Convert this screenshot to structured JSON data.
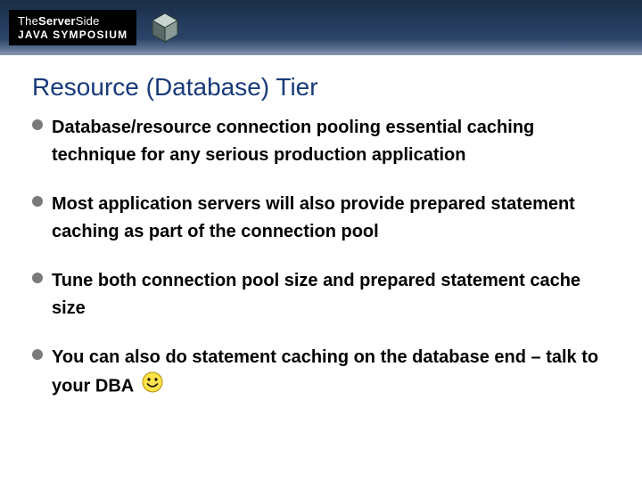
{
  "header": {
    "logo_line1_a": "The",
    "logo_line1_b": "Server",
    "logo_line1_c": "Side",
    "logo_line2": "JAVA SYMPOSIUM"
  },
  "title": "Resource (Database) Tier",
  "bullets": [
    {
      "text": "Database/resource connection pooling essential caching technique for any serious production application"
    },
    {
      "text": "Most application servers will also provide prepared statement caching as part of the connection pool"
    },
    {
      "text": "Tune both connection pool size and prepared statement cache size"
    },
    {
      "text": "You can also do statement caching on the database end – talk to your DBA"
    }
  ]
}
